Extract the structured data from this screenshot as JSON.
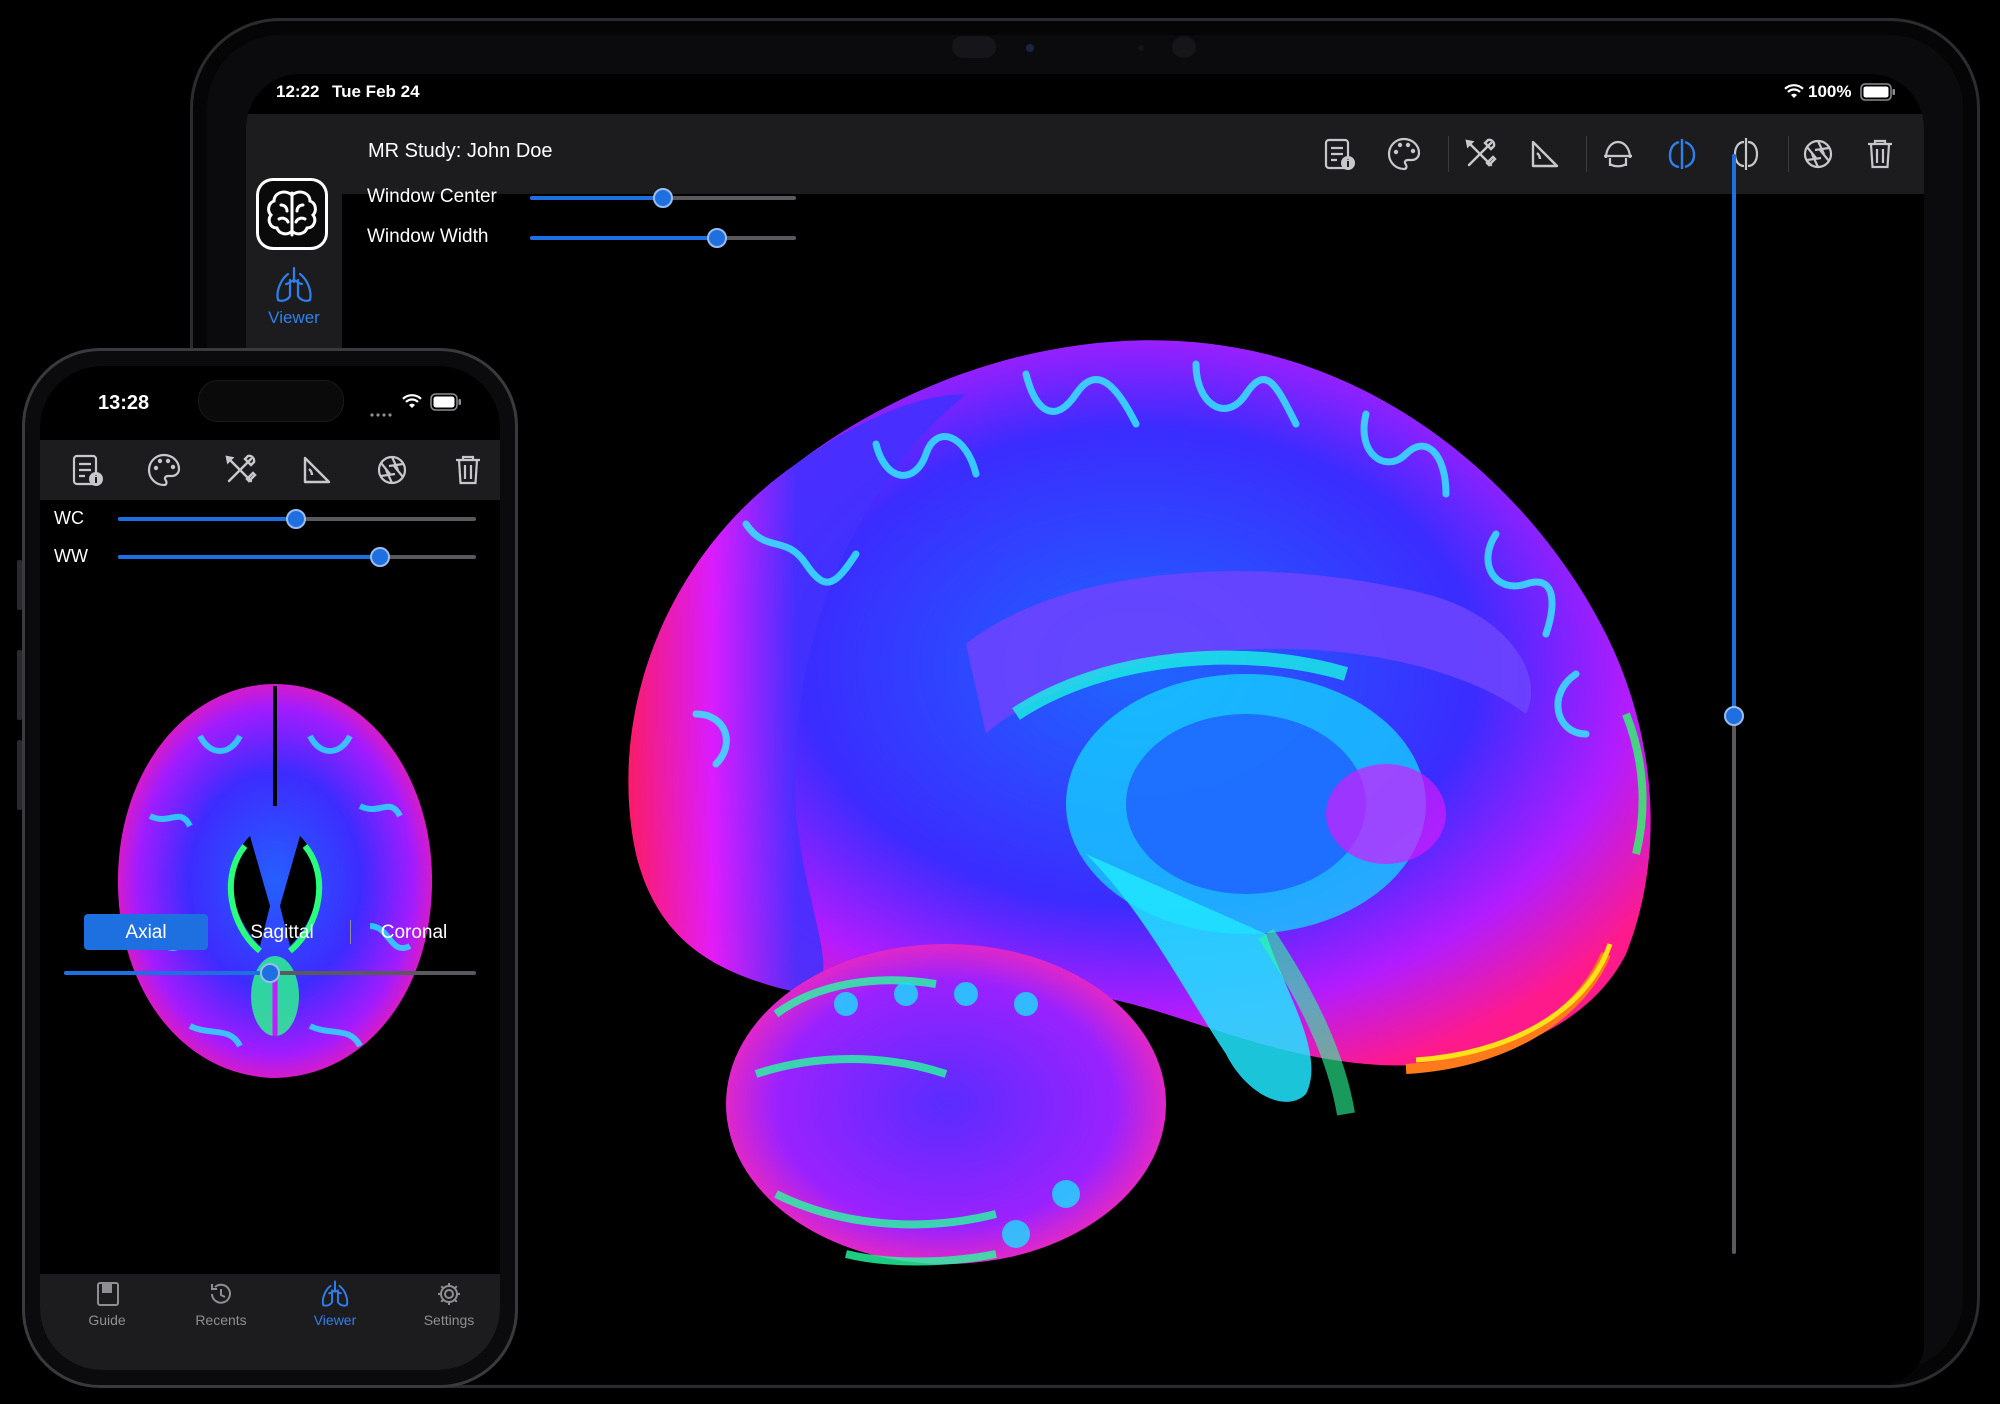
{
  "ipad": {
    "status": {
      "time": "12:22",
      "date": "Tue Feb 24",
      "battery": "100%"
    },
    "sidebar": {
      "app_icon": "brain-icon",
      "viewer_label": "Viewer",
      "viewer_icon": "lungs-icon"
    },
    "toolbar": {
      "title": "MR Study: John Doe",
      "tools": [
        "info-document-icon",
        "palette-icon",
        "tools-icon",
        "ruler-angle-icon",
        "axial-view-icon",
        "sagittal-view-icon",
        "coronal-view-icon",
        "aperture-icon",
        "trash-icon"
      ],
      "active_tool": "sagittal-view-icon"
    },
    "sliders": {
      "window_center_label": "Window Center",
      "window_center_value": 0.5,
      "window_width_label": "Window Width",
      "window_width_value": 0.7
    },
    "slice_slider_value": 0.5,
    "image": "sagittal brain MRI color-mapped"
  },
  "iphone": {
    "status": {
      "time": "13:28"
    },
    "toolbar": {
      "tools": [
        "info-document-icon",
        "palette-icon",
        "tools-icon",
        "ruler-angle-icon",
        "aperture-icon",
        "trash-icon"
      ]
    },
    "sliders": {
      "wc_label": "WC",
      "wc_value": 0.5,
      "ww_label": "WW",
      "ww_value": 0.73
    },
    "segments": {
      "options": [
        "Axial",
        "Sagittal",
        "Coronal"
      ],
      "selected": "Axial"
    },
    "slice_slider_value": 0.5,
    "tabs": [
      {
        "label": "Guide",
        "icon": "book-icon"
      },
      {
        "label": "Recents",
        "icon": "clock-history-icon"
      },
      {
        "label": "Viewer",
        "icon": "lungs-icon"
      },
      {
        "label": "Settings",
        "icon": "gear-icon"
      }
    ],
    "active_tab": "Viewer",
    "image": "axial brain MRI color-mapped"
  },
  "colors": {
    "accent": "#1e6fe0",
    "panel": "#1c1c1e",
    "background": "#000000"
  }
}
